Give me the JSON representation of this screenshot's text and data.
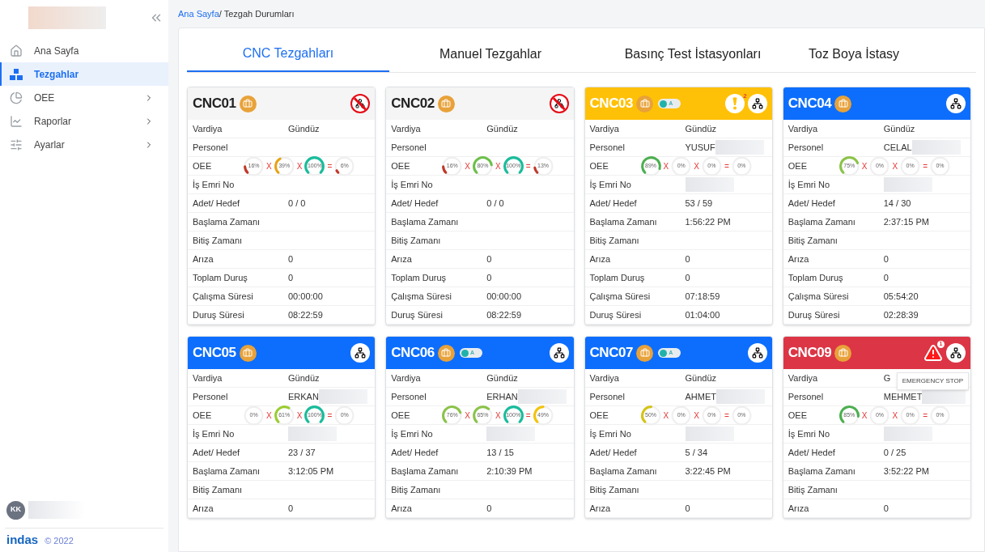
{
  "sidebar": {
    "items": [
      {
        "label": "Ana Sayfa",
        "selected": false,
        "has_submenu": false
      },
      {
        "label": "Tezgahlar",
        "selected": true,
        "has_submenu": false
      },
      {
        "label": "OEE",
        "selected": false,
        "has_submenu": true
      },
      {
        "label": "Raporlar",
        "selected": false,
        "has_submenu": true
      },
      {
        "label": "Ayarlar",
        "selected": false,
        "has_submenu": true
      }
    ],
    "user": {
      "initials": "KK"
    },
    "footer": {
      "brand": "indas",
      "copyright": "© 2022"
    }
  },
  "breadcrumb": [
    {
      "label": "Ana Sayfa",
      "link": true
    },
    {
      "label": " / Tezgah Durumları",
      "link": false
    }
  ],
  "tabs": [
    {
      "label": "CNC Tezgahları",
      "selected": true
    },
    {
      "label": "Manuel Tezgahlar",
      "selected": false
    },
    {
      "label": "Basınç Test İstasyonları",
      "selected": false
    },
    {
      "label": "Toz Boya İstasy",
      "selected": false
    }
  ],
  "machines": [
    {
      "name": "CNC01",
      "color": "#f5f5f5",
      "connected": false,
      "rows": [
        {
          "kind": "text",
          "label": "Vardiya",
          "value": "Gündüz"
        },
        {
          "kind": "text",
          "label": "Personel"
        },
        {
          "kind": "oee",
          "label": "OEE",
          "operators": [
            "X",
            "X",
            "="
          ],
          "gauges": [
            {
              "label": "16%",
              "color": "#c0392b"
            },
            {
              "label": "39%",
              "color": "#e8a317"
            },
            {
              "label": "100%",
              "color": "#1abc9c"
            },
            {
              "label": "6%",
              "color": "#c0392b"
            }
          ]
        },
        {
          "kind": "text",
          "label": "İş Emri No"
        },
        {
          "kind": "text",
          "label": "Adet/ Hedef",
          "value": "0 / 0"
        },
        {
          "kind": "text",
          "label": "Başlama Zamanı"
        },
        {
          "kind": "text",
          "label": "Bitiş Zamanı"
        },
        {
          "kind": "text",
          "label": "Arıza",
          "value": "0"
        },
        {
          "kind": "text",
          "label": "Toplam Duruş",
          "value": "0"
        },
        {
          "kind": "text",
          "label": "Çalışma Süresi",
          "value": "00:00:00"
        },
        {
          "kind": "text",
          "label": "Duruş Süresi",
          "value": "08:22:59"
        }
      ]
    },
    {
      "name": "CNC02",
      "color": "#f5f5f5",
      "connected": false,
      "rows": [
        {
          "kind": "text",
          "label": "Vardiya",
          "value": "Gündüz"
        },
        {
          "kind": "text",
          "label": "Personel"
        },
        {
          "kind": "oee",
          "label": "OEE",
          "operators": [
            "X",
            "X",
            "="
          ],
          "gauges": [
            {
              "label": "16%",
              "color": "#c0392b"
            },
            {
              "label": "80%",
              "color": "#6cc04a"
            },
            {
              "label": "100%",
              "color": "#1abc9c"
            },
            {
              "label": "13%",
              "color": "#c0392b"
            }
          ]
        },
        {
          "kind": "text",
          "label": "İş Emri No"
        },
        {
          "kind": "text",
          "label": "Adet/ Hedef",
          "value": "0 / 0"
        },
        {
          "kind": "text",
          "label": "Başlama Zamanı"
        },
        {
          "kind": "text",
          "label": "Bitiş Zamanı"
        },
        {
          "kind": "text",
          "label": "Arıza",
          "value": "0"
        },
        {
          "kind": "text",
          "label": "Toplam Duruş",
          "value": "0"
        },
        {
          "kind": "text",
          "label": "Çalışma Süresi",
          "value": "00:00:00"
        },
        {
          "kind": "text",
          "label": "Duruş Süresi",
          "value": "08:22:59"
        }
      ]
    },
    {
      "name": "CNC03",
      "color": "#ffc107",
      "connected": true,
      "toggle": {
        "label": "A"
      },
      "alarm": {
        "kind": "warning",
        "count": "2"
      },
      "rows": [
        {
          "kind": "text",
          "label": "Vardiya",
          "value": "Gündüz"
        },
        {
          "kind": "text",
          "label": "Personel",
          "value": "YUSUF",
          "redacted": true
        },
        {
          "kind": "oee",
          "label": "OEE",
          "operators": [
            "X",
            "X",
            "="
          ],
          "gauges": [
            {
              "label": "89%",
              "color": "#4caf50"
            },
            {
              "label": "0%"
            },
            {
              "label": "0%"
            },
            {
              "label": "0%"
            }
          ]
        },
        {
          "kind": "text",
          "label": "İş Emri No",
          "redacted": true
        },
        {
          "kind": "text",
          "label": "Adet/ Hedef",
          "value": "53 / 59"
        },
        {
          "kind": "text",
          "label": "Başlama Zamanı",
          "value": "1:56:22 PM"
        },
        {
          "kind": "text",
          "label": "Bitiş Zamanı"
        },
        {
          "kind": "text",
          "label": "Arıza",
          "value": "0"
        },
        {
          "kind": "text",
          "label": "Toplam Duruş",
          "value": "0"
        },
        {
          "kind": "text",
          "label": "Çalışma Süresi",
          "value": "07:18:59"
        },
        {
          "kind": "text",
          "label": "Duruş Süresi",
          "value": "01:04:00"
        }
      ]
    },
    {
      "name": "CNC04",
      "color": "#0d6efd",
      "connected": true,
      "rows": [
        {
          "kind": "text",
          "label": "Vardiya",
          "value": "Gündüz"
        },
        {
          "kind": "text",
          "label": "Personel",
          "value": "CELAL",
          "redacted": true
        },
        {
          "kind": "oee",
          "label": "OEE",
          "operators": [
            "X",
            "X",
            "="
          ],
          "gauges": [
            {
              "label": "75%",
              "color": "#8bc34a"
            },
            {
              "label": "0%"
            },
            {
              "label": "0%"
            },
            {
              "label": "0%"
            }
          ]
        },
        {
          "kind": "text",
          "label": "İş Emri No",
          "redacted": true
        },
        {
          "kind": "text",
          "label": "Adet/ Hedef",
          "value": "14 / 30"
        },
        {
          "kind": "text",
          "label": "Başlama Zamanı",
          "value": "2:37:15 PM"
        },
        {
          "kind": "text",
          "label": "Bitiş Zamanı"
        },
        {
          "kind": "text",
          "label": "Arıza",
          "value": "0"
        },
        {
          "kind": "text",
          "label": "Toplam Duruş",
          "value": "0"
        },
        {
          "kind": "text",
          "label": "Çalışma Süresi",
          "value": "05:54:20"
        },
        {
          "kind": "text",
          "label": "Duruş Süresi",
          "value": "02:28:39"
        }
      ]
    },
    {
      "name": "CNC05",
      "color": "#0d6efd",
      "connected": true,
      "rows": [
        {
          "kind": "text",
          "label": "Vardiya",
          "value": "Gündüz"
        },
        {
          "kind": "text",
          "label": "Personel",
          "value": "ERKAN",
          "redacted": true
        },
        {
          "kind": "oee",
          "label": "OEE",
          "operators": [
            "X",
            "X",
            "="
          ],
          "gauges": [
            {
              "label": "0%"
            },
            {
              "label": "61%",
              "color": "#9acd32"
            },
            {
              "label": "100%",
              "color": "#1abc9c"
            },
            {
              "label": "0%"
            }
          ]
        },
        {
          "kind": "text",
          "label": "İş Emri No",
          "redacted": true
        },
        {
          "kind": "text",
          "label": "Adet/ Hedef",
          "value": "23 / 37"
        },
        {
          "kind": "text",
          "label": "Başlama Zamanı",
          "value": "3:12:05 PM"
        },
        {
          "kind": "text",
          "label": "Bitiş Zamanı"
        },
        {
          "kind": "text",
          "label": "Arıza",
          "value": "0"
        }
      ]
    },
    {
      "name": "CNC06",
      "color": "#0d6efd",
      "connected": true,
      "toggle": {
        "label": "A"
      },
      "rows": [
        {
          "kind": "text",
          "label": "Vardiya",
          "value": "Gündüz"
        },
        {
          "kind": "text",
          "label": "Personel",
          "value": "ERHAN",
          "redacted": true
        },
        {
          "kind": "oee",
          "label": "OEE",
          "operators": [
            "X",
            "X",
            "="
          ],
          "gauges": [
            {
              "label": "76%",
              "color": "#8bc34a"
            },
            {
              "label": "65%",
              "color": "#8bc34a"
            },
            {
              "label": "100%",
              "color": "#1abc9c"
            },
            {
              "label": "49%",
              "color": "#f1c40f"
            }
          ]
        },
        {
          "kind": "text",
          "label": "İş Emri No",
          "redacted": true
        },
        {
          "kind": "text",
          "label": "Adet/ Hedef",
          "value": "13 / 15"
        },
        {
          "kind": "text",
          "label": "Başlama Zamanı",
          "value": "2:10:39 PM"
        },
        {
          "kind": "text",
          "label": "Bitiş Zamanı"
        },
        {
          "kind": "text",
          "label": "Arıza",
          "value": "0"
        }
      ]
    },
    {
      "name": "CNC07",
      "color": "#0d6efd",
      "connected": true,
      "toggle": {
        "label": "A"
      },
      "rows": [
        {
          "kind": "text",
          "label": "Vardiya",
          "value": "Gündüz"
        },
        {
          "kind": "text",
          "label": "Personel",
          "value": "AHMET",
          "redacted": true
        },
        {
          "kind": "oee",
          "label": "OEE",
          "operators": [
            "X",
            "X",
            "="
          ],
          "gauges": [
            {
              "label": "50%",
              "color": "#d4c41a"
            },
            {
              "label": "0%"
            },
            {
              "label": "0%"
            },
            {
              "label": "0%"
            }
          ]
        },
        {
          "kind": "text",
          "label": "İş Emri No",
          "redacted": true
        },
        {
          "kind": "text",
          "label": "Adet/ Hedef",
          "value": "5 / 34"
        },
        {
          "kind": "text",
          "label": "Başlama Zamanı",
          "value": "3:22:45 PM"
        },
        {
          "kind": "text",
          "label": "Bitiş Zamanı"
        },
        {
          "kind": "text",
          "label": "Arıza",
          "value": "0"
        }
      ]
    },
    {
      "name": "CNC09",
      "color": "#dc3545",
      "connected": true,
      "alarm": {
        "kind": "emergency",
        "count": "1",
        "tooltip": "EMERGENCY STOP"
      },
      "rows": [
        {
          "kind": "text",
          "label": "Vardiya",
          "value": "G"
        },
        {
          "kind": "text",
          "label": "Personel",
          "value": "MEHMET",
          "redacted": true
        },
        {
          "kind": "oee",
          "label": "OEE",
          "operators": [
            "X",
            "X",
            "="
          ],
          "gauges": [
            {
              "label": "85%",
              "color": "#4caf50"
            },
            {
              "label": "0%"
            },
            {
              "label": "0%"
            },
            {
              "label": "0%"
            }
          ]
        },
        {
          "kind": "text",
          "label": "İş Emri No",
          "redacted": true
        },
        {
          "kind": "text",
          "label": "Adet/ Hedef",
          "value": "0 / 25"
        },
        {
          "kind": "text",
          "label": "Başlama Zamanı",
          "value": "3:52:22 PM"
        },
        {
          "kind": "text",
          "label": "Bitiş Zamanı"
        },
        {
          "kind": "text",
          "label": "Arıza",
          "value": "0"
        }
      ]
    }
  ]
}
